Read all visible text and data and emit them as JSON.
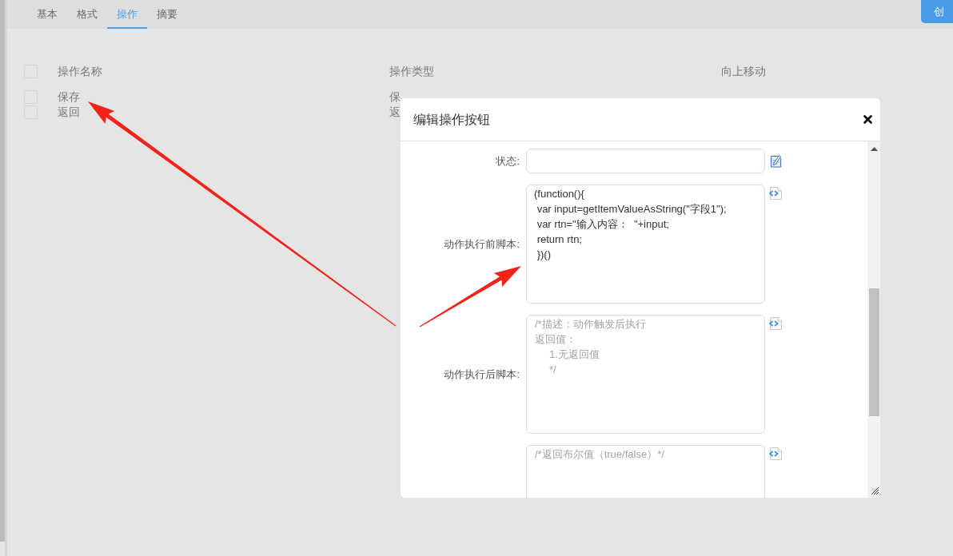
{
  "tabs": [
    {
      "label": "基本",
      "selected": false
    },
    {
      "label": "格式",
      "selected": false
    },
    {
      "label": "操作",
      "selected": true
    },
    {
      "label": "摘要",
      "selected": false
    }
  ],
  "create_button": {
    "label": "创"
  },
  "table": {
    "select_all": {
      "checked": false
    },
    "columns": [
      "操作名称",
      "操作类型",
      "向上移动"
    ],
    "rows": [
      {
        "checked": false,
        "cells": [
          "保存",
          "保"
        ]
      },
      {
        "checked": false,
        "cells": [
          "返回",
          "返"
        ]
      }
    ]
  },
  "dialog": {
    "title": "编辑操作按钮",
    "fields": [
      {
        "kind": "text",
        "label": "状态:"
      },
      {
        "kind": "script",
        "label": "动作执行前脚本:",
        "value": "(function(){\n var input=getItemValueAsString(\"字段1\");\n var rtn=\"输入内容：  \"+input;\n return rtn;\n })()"
      },
      {
        "kind": "script",
        "label": "动作执行后脚本:",
        "placeholder": [
          "/*描述：动作触发后执行",
          "返回值：",
          "     1.无返回值",
          "     */"
        ]
      },
      {
        "kind": "script",
        "placeholder": [
          "/*返回布尔值（true/false）*/"
        ]
      }
    ]
  }
}
